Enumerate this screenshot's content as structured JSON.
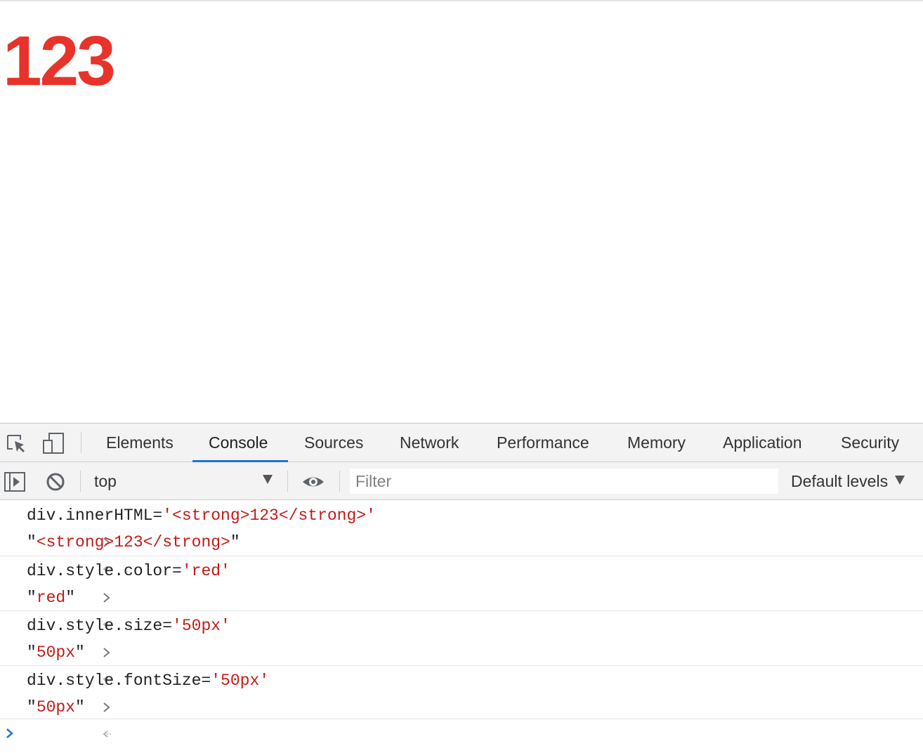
{
  "page": {
    "content_text": "123",
    "content_color": "#e8332a"
  },
  "devtools": {
    "tabs": [
      {
        "label": "Elements"
      },
      {
        "label": "Console",
        "active": true
      },
      {
        "label": "Sources"
      },
      {
        "label": "Network"
      },
      {
        "label": "Performance"
      },
      {
        "label": "Memory"
      },
      {
        "label": "Application"
      },
      {
        "label": "Security"
      }
    ],
    "toolbar": {
      "context": "top",
      "filter_placeholder": "Filter",
      "levels_label": "Default levels"
    },
    "console": {
      "entries": [
        {
          "input": {
            "plain": "div.innerHTML=",
            "string": "'<strong>123</strong>'"
          },
          "output": {
            "string": "<strong>123</strong>"
          }
        },
        {
          "input": {
            "plain": "div.style.color=",
            "string": "'red'"
          },
          "output": {
            "string": "red"
          }
        },
        {
          "input": {
            "plain": "div.style.size=",
            "string": "'50px'"
          },
          "output": {
            "string": "50px"
          }
        },
        {
          "input": {
            "plain": "div.style.fontSize=",
            "string": "'50px'"
          },
          "output": {
            "string": "50px"
          }
        }
      ]
    },
    "accent_color": "#1a73e8",
    "icons": {
      "inspect": "inspect-element-icon",
      "device": "device-toolbar-icon",
      "sidebar": "show-sidebar-icon",
      "clear": "clear-console-icon",
      "eye": "live-expression-icon",
      "prompt": "console-prompt-icon"
    }
  }
}
